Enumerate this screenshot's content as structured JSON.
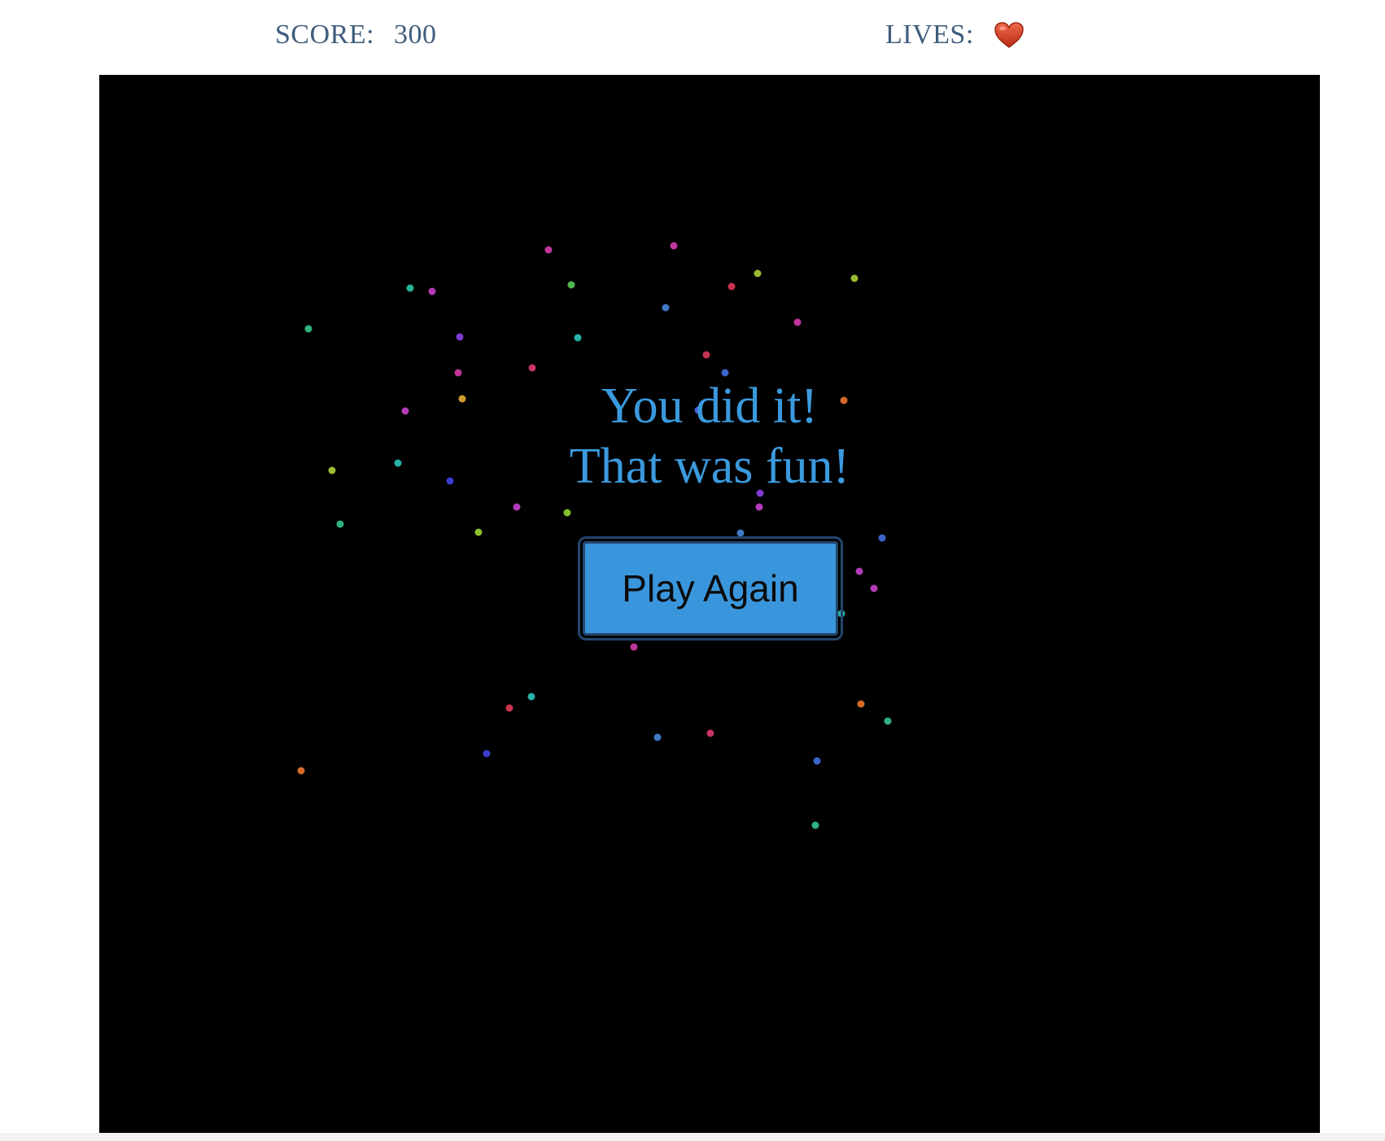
{
  "hud": {
    "score_label": "SCORE:",
    "score_value": "300",
    "lives_label": "LIVES:",
    "lives_icon": "heart-icon",
    "lives_count": 1
  },
  "game": {
    "message_line1": "You did it!",
    "message_line2": "That was fun!",
    "play_again_label": "Play Again"
  },
  "colors": {
    "message": "#3b9ade",
    "button_bg": "#3a96dc",
    "button_border": "#23456e",
    "hud_text": "#3f5d7d",
    "heart": "#d9412a",
    "canvas_bg": "#000000"
  }
}
